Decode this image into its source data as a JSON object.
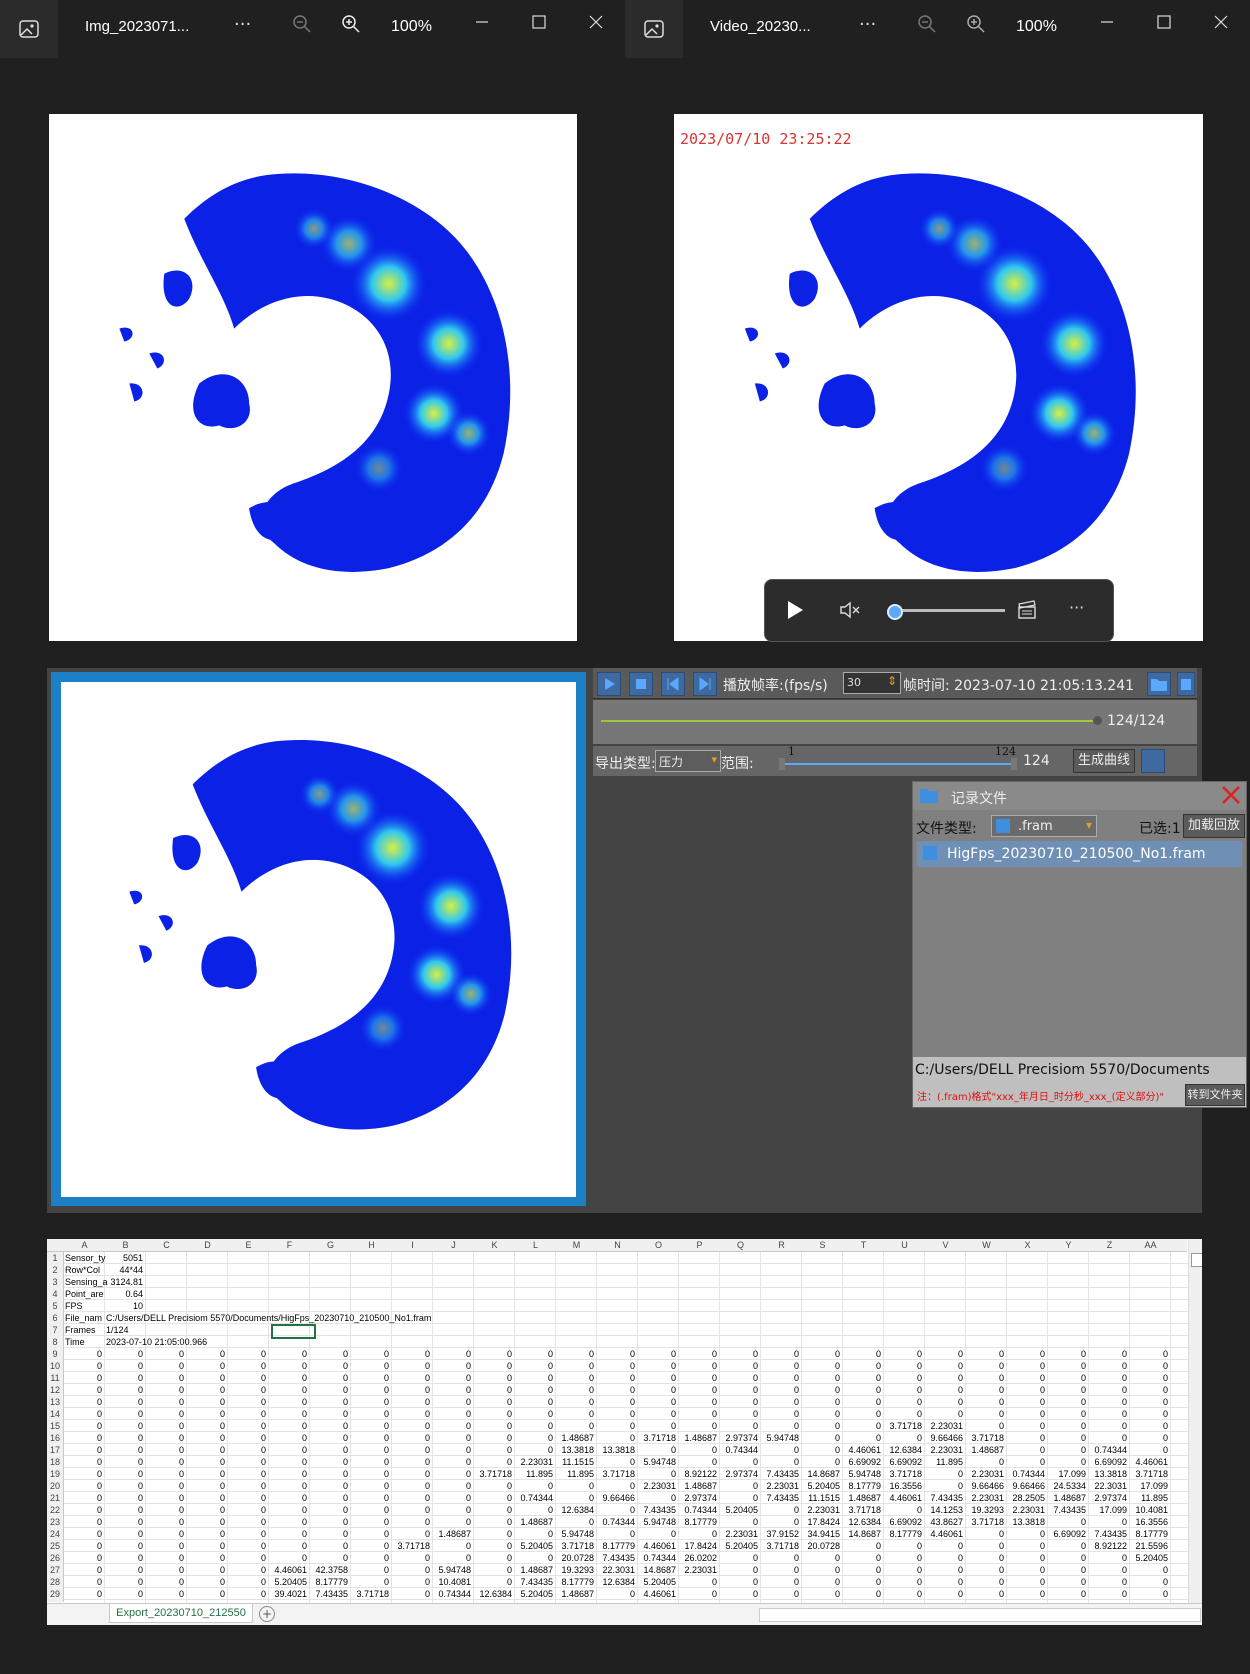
{
  "viewer_left": {
    "title": "Img_2023071...",
    "more": "···",
    "zoom": "100%"
  },
  "viewer_right": {
    "title": "Video_20230...",
    "more": "···",
    "zoom": "100%"
  },
  "video": {
    "timestamp": "2023/07/10 23:25:22",
    "more": "···"
  },
  "software": {
    "fps_label": "播放帧率:(fps/s)",
    "fps_value": "30",
    "frame_time": "帧时间: 2023-07-10 21:05:13.241",
    "progress": "124/124",
    "progress_fraction": 1.0,
    "export_type_label": "导出类型:",
    "export_type_value": "压力",
    "range_label": "范围:",
    "range_min": "1",
    "range_max": "124",
    "range_value": "124",
    "gen_curve": "生成曲线"
  },
  "records": {
    "title": "记录文件",
    "file_type_label": "文件类型:",
    "file_type_value": ".fram",
    "selected": "已选:1",
    "load_button": "加载回放",
    "items": [
      "HigFps_20230710_210500_No1.fram"
    ],
    "path": "C:/Users/DELL Precisiom 5570/Documents",
    "note": "注：(.fram)格式\"xxx_年月日_时分秒_xxx_(定义部分)\"",
    "goto_button": "转到文件夹"
  },
  "sheet": {
    "columns": [
      "A",
      "B",
      "C",
      "D",
      "E",
      "F",
      "G",
      "H",
      "I",
      "J",
      "K",
      "L",
      "M",
      "N",
      "O",
      "P",
      "Q",
      "R",
      "S",
      "T",
      "U",
      "V",
      "W",
      "X",
      "Y",
      "Z",
      "AA"
    ],
    "meta": [
      {
        "row": "1",
        "a": "Sensor_ty",
        "b": "5051"
      },
      {
        "row": "2",
        "a": "Row*Col",
        "b": "44*44"
      },
      {
        "row": "3",
        "a": "Sensing_a",
        "b": "3124.81"
      },
      {
        "row": "4",
        "a": "Point_are",
        "b": "0.64"
      },
      {
        "row": "5",
        "a": "FPS",
        "b": "10"
      },
      {
        "row": "6",
        "a": "File_nam",
        "b": "C:/Users/DELL Precisiom 5570/Documents/HigFps_20230710_210500_No1.fram"
      },
      {
        "row": "7",
        "a": "Frames",
        "b": "1/124"
      },
      {
        "row": "8",
        "a": "Time",
        "b": "2023-07-10 21:05:00.966"
      }
    ],
    "data_rows": [
      {
        "row": "9",
        "cells": {}
      },
      {
        "row": "10",
        "cells": {}
      },
      {
        "row": "11",
        "cells": {}
      },
      {
        "row": "12",
        "cells": {}
      },
      {
        "row": "13",
        "cells": {}
      },
      {
        "row": "14",
        "cells": {}
      },
      {
        "row": "15",
        "cells": {
          "20": "3.71718",
          "21": "2.23031"
        }
      },
      {
        "row": "16",
        "cells": {
          "12": "1.48687",
          "14": "3.71718",
          "15": "1.48687",
          "16": "2.97374",
          "17": "5.94748",
          "21": "9.66466",
          "22": "3.71718"
        }
      },
      {
        "row": "17",
        "cells": {
          "12": "13.3818",
          "13": "13.3818",
          "16": "0.74344",
          "19": "4.46061",
          "20": "12.6384",
          "21": "2.23031",
          "22": "1.48687",
          "25": "0.74344"
        }
      },
      {
        "row": "18",
        "cells": {
          "11": "2.23031",
          "12": "11.1515",
          "14": "5.94748",
          "19": "6.69092",
          "20": "6.69092",
          "21": "11.895",
          "25": "6.69092",
          "26": "4.46061"
        }
      },
      {
        "row": "19",
        "cells": {
          "10": "3.71718",
          "11": "11.895",
          "12": "11.895",
          "13": "3.71718",
          "15": "8.92122",
          "16": "2.97374",
          "17": "7.43435",
          "18": "14.8687",
          "19": "5.94748",
          "20": "3.71718",
          "22": "2.23031",
          "23": "0.74344",
          "24": "17.099",
          "25": "13.3818",
          "26": "3.71718"
        }
      },
      {
        "row": "20",
        "cells": {
          "14": "2.23031",
          "15": "1.48687",
          "17": "2.23031",
          "18": "5.20405",
          "19": "8.17779",
          "20": "16.3556",
          "22": "9.66466",
          "23": "9.66466",
          "24": "24.5334",
          "25": "22.3031",
          "26": "17.099"
        }
      },
      {
        "row": "21",
        "cells": {
          "11": "0.74344",
          "13": "9.66466",
          "15": "2.97374",
          "17": "7.43435",
          "18": "11.1515",
          "19": "1.48687",
          "20": "4.46061",
          "21": "7.43435",
          "22": "2.23031",
          "23": "28.2505",
          "24": "1.48687",
          "25": "2.97374",
          "26": "11.895"
        }
      },
      {
        "row": "22",
        "cells": {
          "12": "12.6384",
          "14": "7.43435",
          "15": "0.74344",
          "16": "5.20405",
          "18": "2.23031",
          "19": "3.71718",
          "21": "14.1253",
          "22": "19.3293",
          "23": "2.23031",
          "24": "7.43435",
          "25": "17.099",
          "26": "10.4081"
        }
      },
      {
        "row": "23",
        "cells": {
          "11": "1.48687",
          "13": "0.74344",
          "14": "5.94748",
          "15": "8.17779",
          "18": "17.8424",
          "19": "12.6384",
          "20": "6.69092",
          "21": "43.8627",
          "22": "3.71718",
          "23": "13.3818",
          "26": "16.3556"
        }
      },
      {
        "row": "24",
        "cells": {
          "9": "1.48687",
          "12": "5.94748",
          "16": "2.23031",
          "17": "37.9152",
          "18": "34.9415",
          "19": "14.8687",
          "20": "8.17779",
          "21": "4.46061",
          "24": "6.69092",
          "25": "7.43435",
          "26": "8.17779"
        }
      },
      {
        "row": "25",
        "cells": {
          "8": "3.71718",
          "11": "5.20405",
          "12": "3.71718",
          "13": "8.17779",
          "14": "4.46061",
          "15": "17.8424",
          "16": "5.20405",
          "17": "3.71718",
          "18": "20.0728",
          "25": "8.92122",
          "26": "21.5596"
        }
      },
      {
        "row": "26",
        "cells": {
          "12": "20.0728",
          "13": "7.43435",
          "14": "0.74344",
          "15": "26.0202",
          "26": "5.20405"
        }
      },
      {
        "row": "27",
        "cells": {
          "5": "4.46061",
          "6": "42.3758",
          "9": "5.94748",
          "11": "1.48687",
          "12": "19.3293",
          "13": "22.3031",
          "14": "14.8687",
          "15": "2.23031"
        }
      },
      {
        "row": "28",
        "cells": {
          "5": "5.20405",
          "6": "8.17779",
          "9": "10.4081",
          "11": "7.43435",
          "12": "8.17779",
          "13": "12.6384",
          "14": "5.20405"
        }
      },
      {
        "row": "29",
        "cells": {
          "5": "39.4021",
          "6": "7.43435",
          "7": "3.71718",
          "9": "0.74344",
          "10": "12.6384",
          "11": "5.20405",
          "12": "1.48687",
          "14": "4.46061"
        }
      }
    ],
    "tab": "Export_20230710_212550"
  },
  "colors": {
    "heatmap_low": "#0a20e8",
    "heatmap_mid": "#22b4f0",
    "heatmap_high": "#d8f040",
    "accent": "#1d7fc6"
  }
}
